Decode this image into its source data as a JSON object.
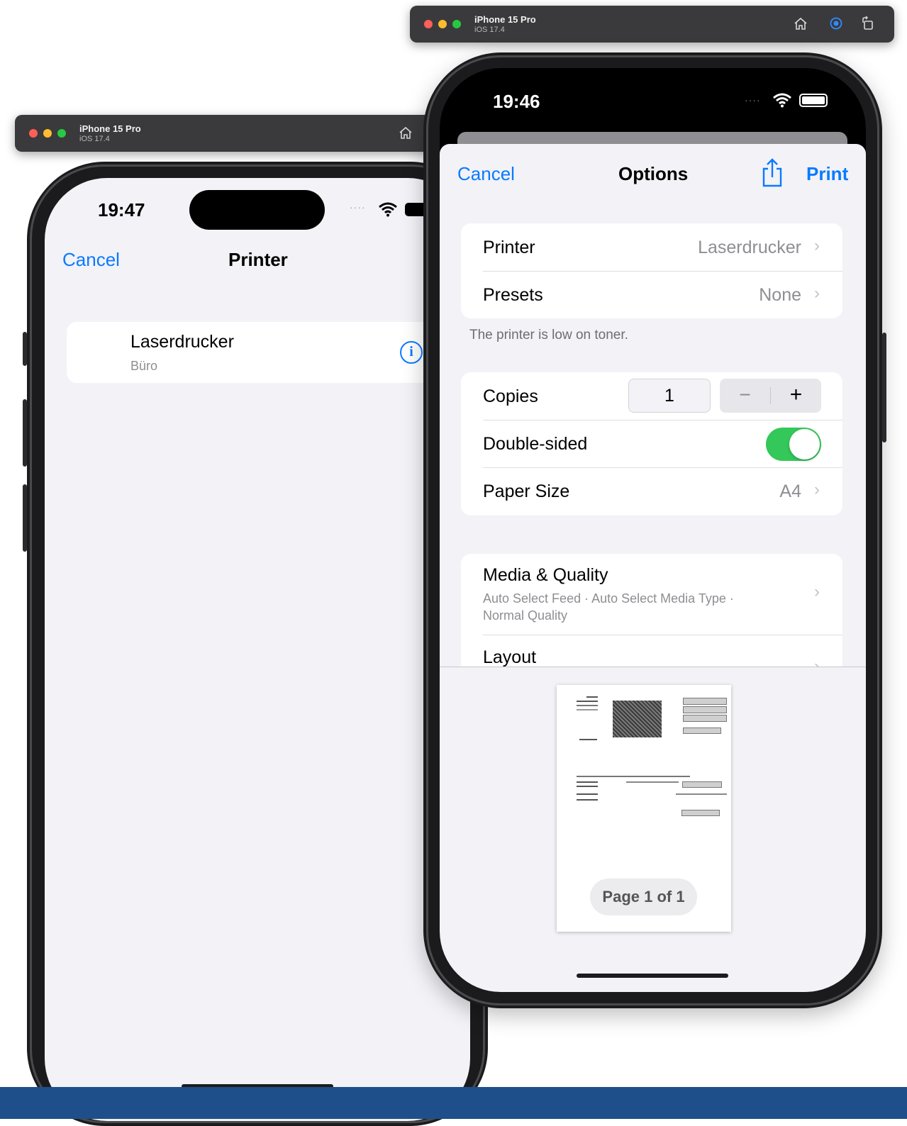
{
  "sim_back": {
    "name": "iPhone 15 Pro",
    "os": "iOS 17.4"
  },
  "sim_front": {
    "name": "iPhone 15 Pro",
    "os": "iOS 17.4"
  },
  "back_phone": {
    "time": "19:47",
    "nav": {
      "cancel": "Cancel",
      "title": "Printer"
    },
    "printer_item": {
      "name": "Laserdrucker",
      "location": "Büro"
    }
  },
  "front_phone": {
    "time": "19:46",
    "nav": {
      "cancel": "Cancel",
      "title": "Options",
      "print": "Print"
    },
    "printer_group": {
      "printer_label": "Printer",
      "printer_value": "Laserdrucker",
      "presets_label": "Presets",
      "presets_value": "None"
    },
    "toner_note": "The printer is low on toner.",
    "settings_group": {
      "copies_label": "Copies",
      "copies_value": "1",
      "minus": "−",
      "plus": "+",
      "double_sided_label": "Double-sided",
      "double_sided_on": true,
      "paper_size_label": "Paper Size",
      "paper_size_value": "A4"
    },
    "more_group": {
      "media_label": "Media & Quality",
      "media_detail_1": "Auto Select Feed · Auto Select Media Type ·",
      "media_detail_2": "Normal Quality",
      "layout_label": "Layout"
    },
    "preview": {
      "page_indicator": "Page 1 of 1"
    }
  },
  "colors": {
    "accent": "#0a7aff",
    "toggle_on": "#34c759",
    "banner": "#1e4f8a"
  }
}
